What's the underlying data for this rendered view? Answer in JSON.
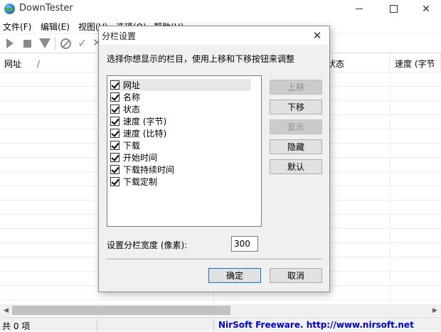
{
  "window": {
    "title": "DownTester",
    "minimize_label": "",
    "maximize_label": "",
    "close_label": "✕"
  },
  "menu": {
    "items": [
      "文件(F)",
      "编辑(E)",
      "视图(V)",
      "选项(O)",
      "帮助(H)"
    ]
  },
  "toolbar": {
    "icons": [
      "play-icon",
      "stop-icon",
      "download-icon",
      "cancel-icon",
      "check-icon",
      "x-icon"
    ]
  },
  "list": {
    "columns": [
      "网址",
      "状态",
      "速度 (字节"
    ],
    "sort_indicator": "/"
  },
  "statusbar": {
    "count": "共 0 项",
    "link": "NirSoft Freeware.  http://www.nirsoft.net"
  },
  "dialog": {
    "title": "分栏设置",
    "close_label": "✕",
    "instruction": "选择你想显示的栏目，使用上移和下移按钮来调整",
    "columns": [
      {
        "label": "网址",
        "checked": true,
        "selected": true
      },
      {
        "label": "名称",
        "checked": true
      },
      {
        "label": "状态",
        "checked": true
      },
      {
        "label": "速度 (字节)",
        "checked": true
      },
      {
        "label": "速度 (比特)",
        "checked": true
      },
      {
        "label": "下载",
        "checked": true
      },
      {
        "label": "开始时间",
        "checked": true
      },
      {
        "label": "下载持续时间",
        "checked": true
      },
      {
        "label": "下载定制",
        "checked": true
      }
    ],
    "buttons": {
      "move_up": "上移",
      "move_down": "下移",
      "show": "显示",
      "hide": "隐藏",
      "default": "默认",
      "ok": "确定",
      "cancel": "取消"
    },
    "width_label": "设置分栏宽度 (像素):",
    "width_value": "300"
  },
  "colors": {
    "link": "#0000cc",
    "dialog_bg": "#f0f0f0",
    "focus_border": "#0078d7"
  }
}
